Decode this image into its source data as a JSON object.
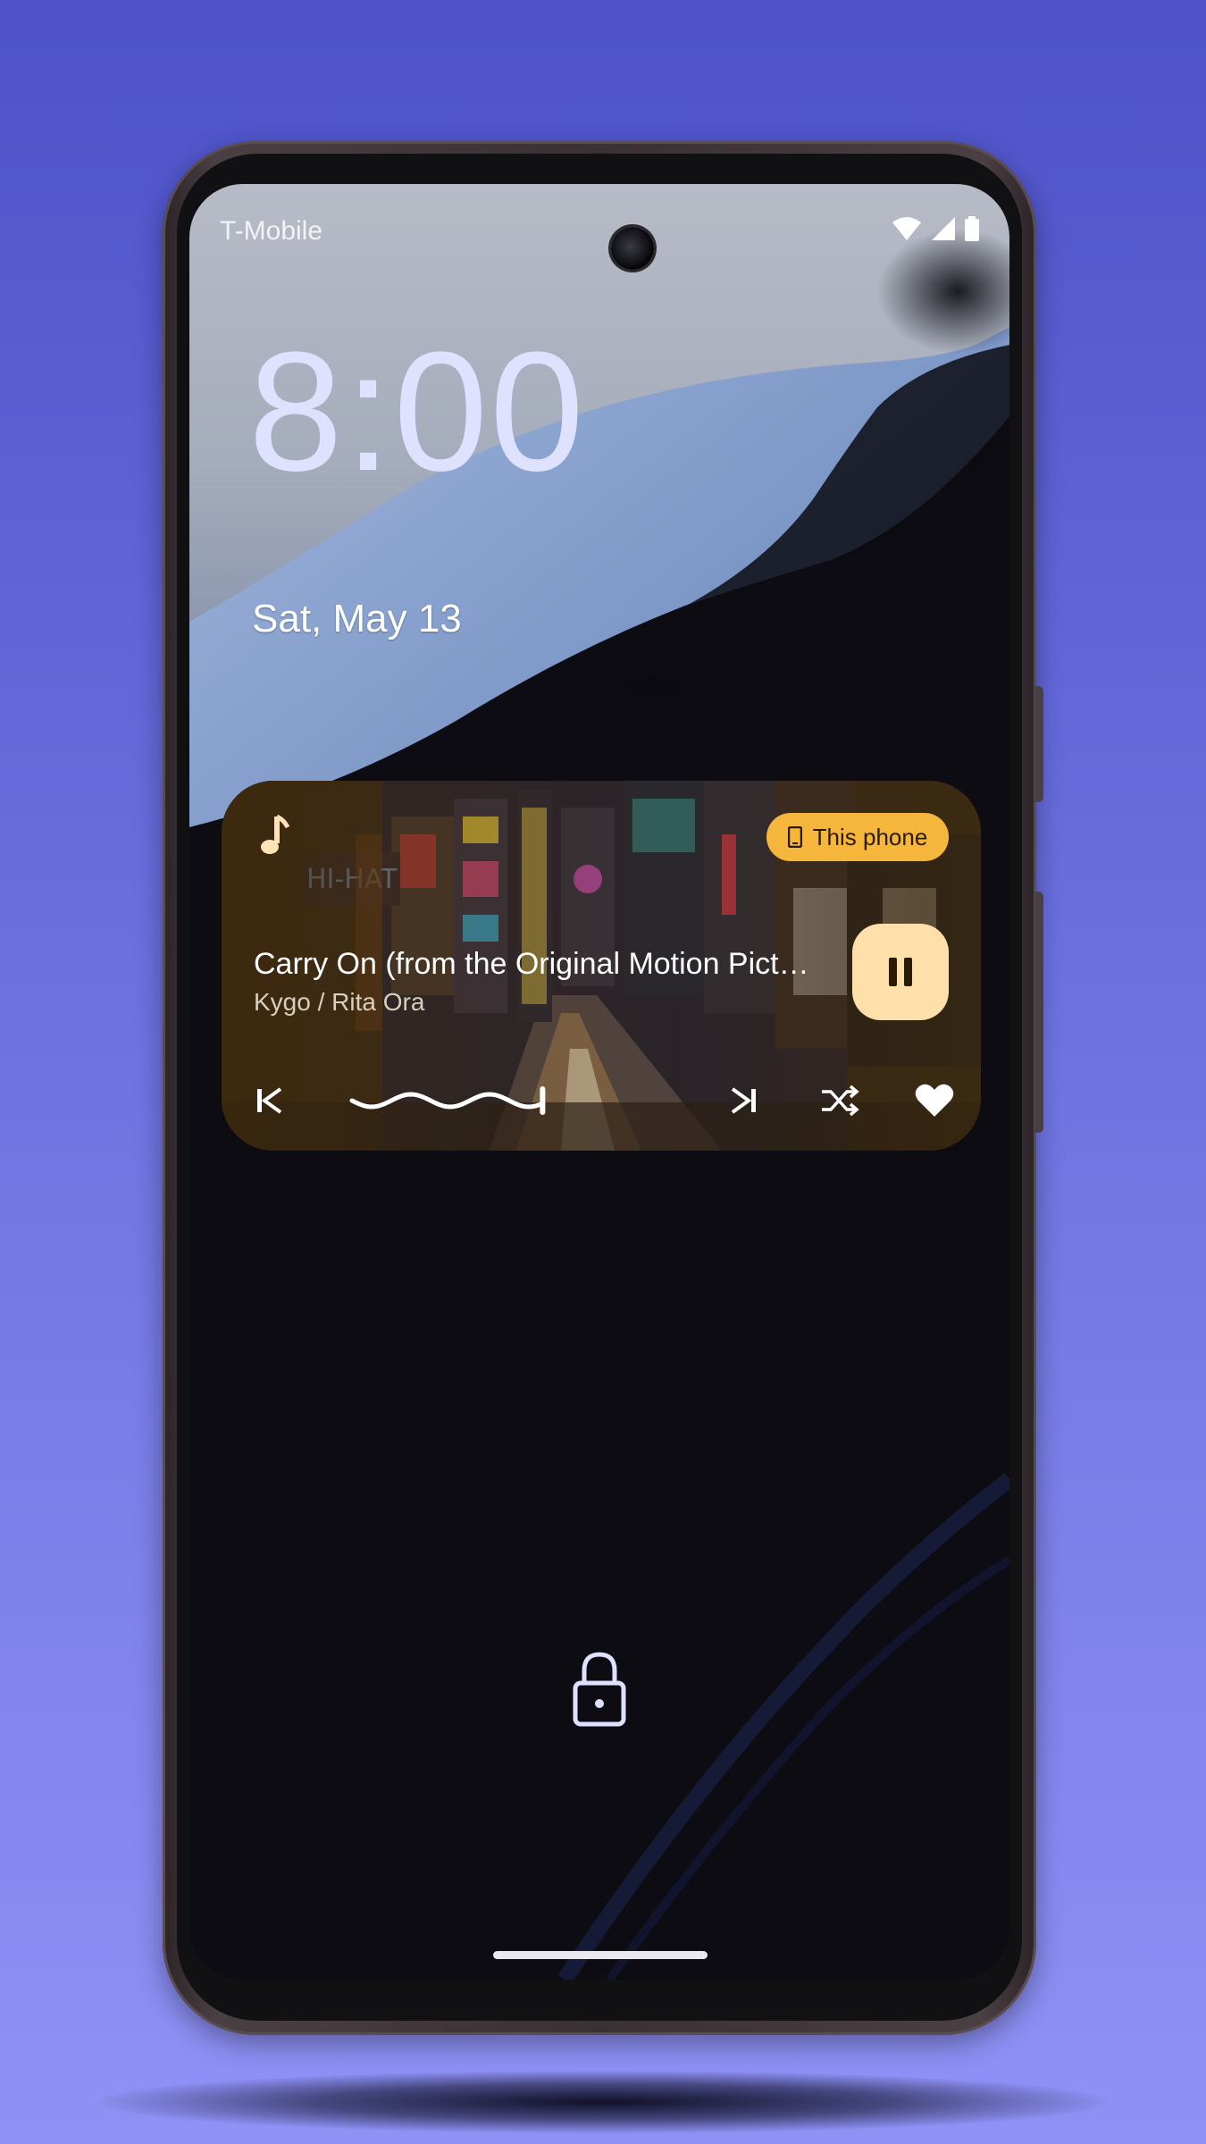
{
  "status_bar": {
    "carrier": "T-Mobile",
    "icons": [
      "wifi-icon",
      "signal-icon",
      "battery-icon"
    ]
  },
  "lockscreen": {
    "time": "8:00",
    "date": "Sat, May 13"
  },
  "media_player": {
    "app_icon": "music-note-icon",
    "output_chip_label": "This phone",
    "output_chip_icon": "phone-icon",
    "title": "Carry On (from the Original Motion Picture \"POKÉMON Detective Pikachu\")",
    "artist": "Kygo / Rita Ora",
    "playback_state": "playing",
    "progress_fraction": 0.42,
    "controls": [
      "skip-previous-icon",
      "squiggly-seekbar",
      "skip-next-icon",
      "shuffle-icon",
      "heart-icon"
    ],
    "colors": {
      "chip": "#f6b53b",
      "play_button": "#ffdfaa"
    }
  },
  "bottom": {
    "lock_icon": "lock-icon"
  }
}
